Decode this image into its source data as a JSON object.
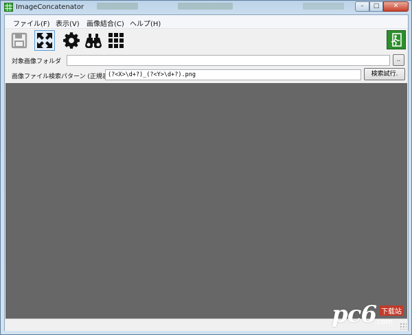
{
  "window": {
    "title": "ImageConcatenator",
    "controls": {
      "minimize": "–",
      "maximize": "□",
      "close": "✕"
    }
  },
  "menu": {
    "file": "ファイル(F)",
    "view": "表示(V)",
    "combine": "画像結合(C)",
    "help": "ヘルプ(H)"
  },
  "toolbar": {
    "buttons": [
      "save-icon",
      "fit-icon",
      "gear-icon",
      "binoculars-icon",
      "grid-icon",
      "exit-icon"
    ]
  },
  "form": {
    "folder_label": "対象画像フォルダ",
    "folder_value": "",
    "browse_label": "..",
    "pattern_label": "画像ファイル検索パターン (正規表現)",
    "pattern_value": "(?<X>\\d+?)_(?<Y>\\d+?).png",
    "search_button": "検索試行."
  },
  "watermark": {
    "brand": "pc6",
    "suffix": ".com",
    "badge": "下载站"
  },
  "colors": {
    "canvas": "#676767",
    "exit_button": "#2d8e2d",
    "active_tool_border": "#5b9bd5"
  }
}
